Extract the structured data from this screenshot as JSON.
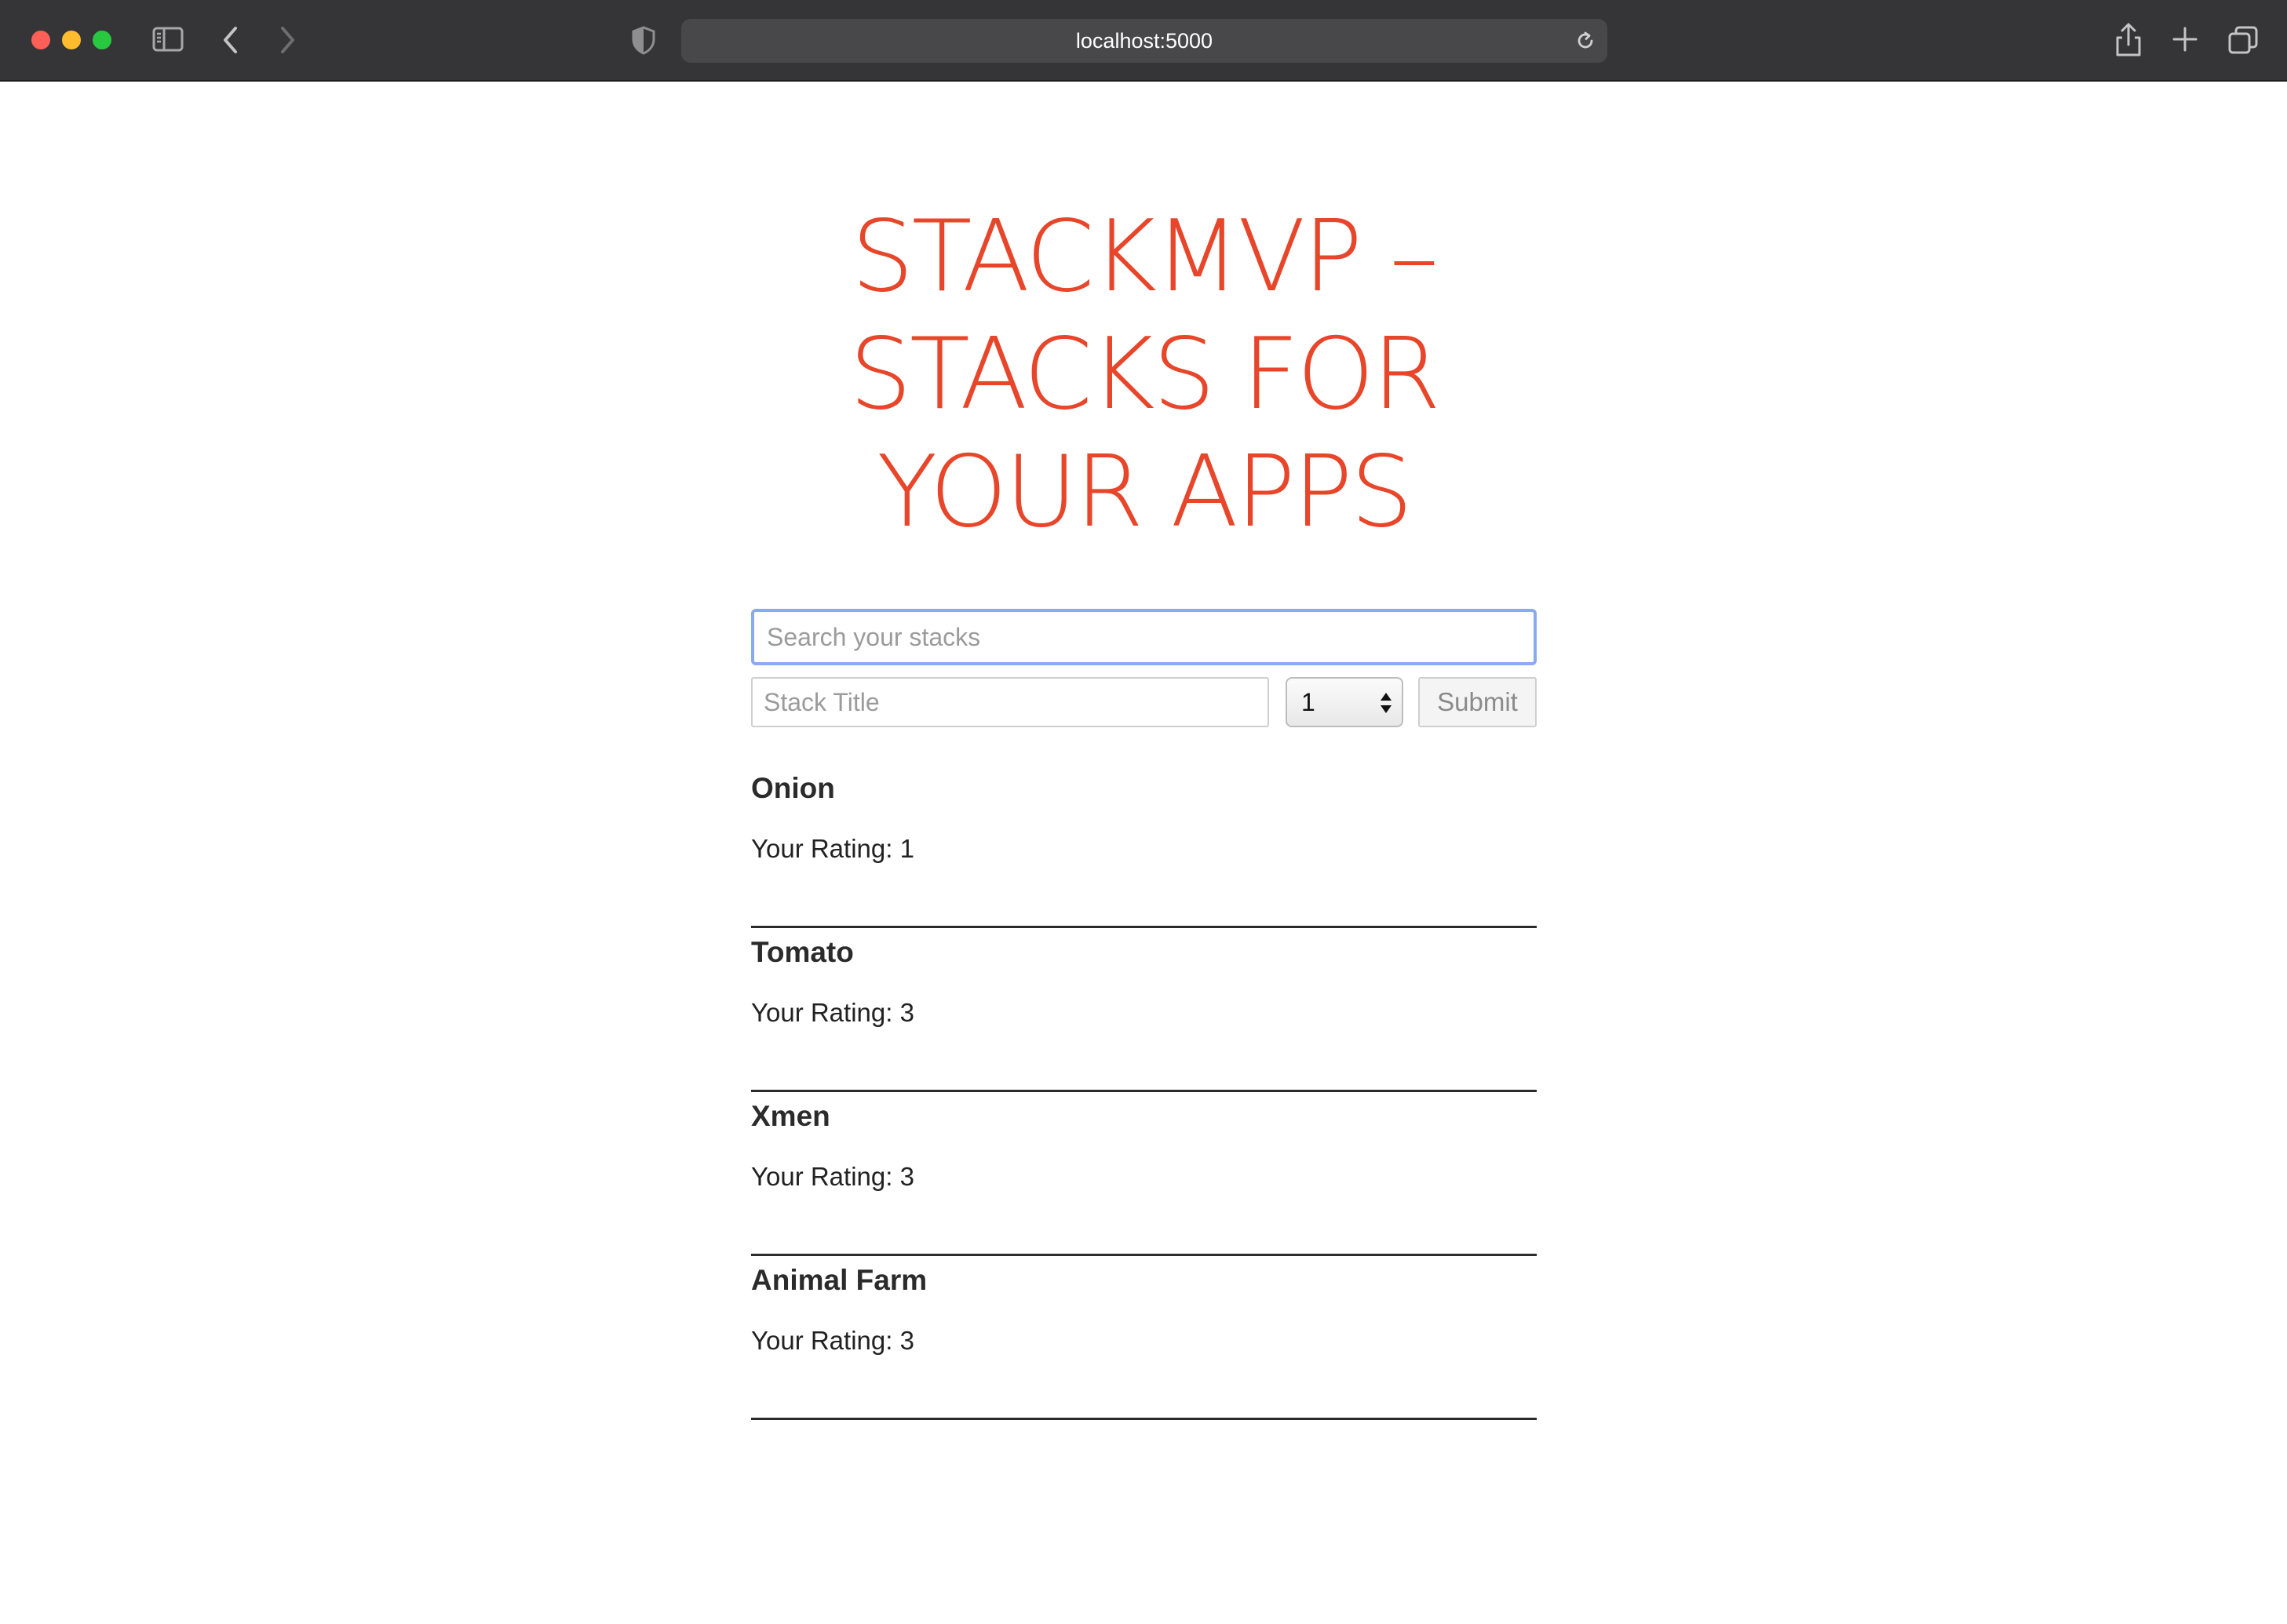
{
  "browser": {
    "url": "localhost:5000",
    "icons": {
      "sidebar": "sidebar-toggle-icon",
      "back": "chevron-left-icon",
      "forward": "chevron-right-icon",
      "privacy": "shield-icon",
      "reload": "reload-icon",
      "share": "share-icon",
      "new_tab": "plus-icon",
      "tab_overview": "tabs-overview-icon"
    },
    "colors": {
      "chrome_bg": "#353537",
      "address_bg": "#48484a",
      "close": "#fe5f57",
      "minimize": "#febc2e",
      "maximize": "#28c840"
    }
  },
  "page": {
    "title": "StackMVP – Stacks for your apps",
    "accent_color": "#e8462a",
    "search": {
      "placeholder": "Search your stacks",
      "value": ""
    },
    "form": {
      "title_placeholder": "Stack Title",
      "title_value": "",
      "rating_selected": "1",
      "submit_label": "Submit"
    },
    "rating_prefix": "Your Rating: ",
    "stacks": [
      {
        "name": "Onion",
        "rating_text": "Your Rating: 1"
      },
      {
        "name": "Tomato",
        "rating_text": "Your Rating: 3"
      },
      {
        "name": "Xmen",
        "rating_text": "Your Rating: 3"
      },
      {
        "name": "Animal Farm",
        "rating_text": "Your Rating: 3"
      }
    ]
  }
}
